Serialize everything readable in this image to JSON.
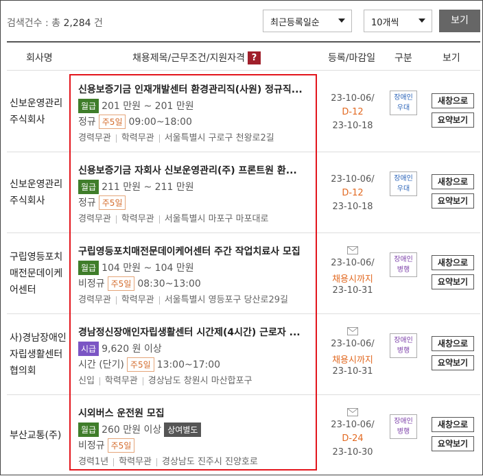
{
  "search": {
    "count_label": "검색건수 : 총",
    "count_value": "2,284",
    "count_unit": "건",
    "sort_selected": "최근등록일순",
    "per_page_selected": "10개씩",
    "view_button": "보기"
  },
  "columns": {
    "company": "회사명",
    "title": "채용제목/근무조건/지원자격",
    "help": "?",
    "dates": "등록/마감일",
    "kind": "구분",
    "view": "보기"
  },
  "buttons": {
    "new_window": "새창으로",
    "summary": "요약보기"
  },
  "jobs": [
    {
      "company": "신보운영관리주식회사",
      "title": "신용보증기금 인재개발센터 환경관리직(사원) 정규직...",
      "pay_type": "월급",
      "pay": "201 만원 ~ 201 만원",
      "employment": "정규",
      "week": "주5일",
      "hours": "09:00~18:00",
      "bonus": "",
      "experience": "경력무관",
      "education": "학력무관",
      "location": "서울특별시 구로구 천왕로2길",
      "registered": "23-10-06/",
      "deadline": "D-12",
      "closing": "23-10-18",
      "kind_line1": "장애인",
      "kind_line2": "우대"
    },
    {
      "company": "신보운영관리주식회사",
      "title": "신용보증기금 자회사 신보운영관리(주) 프론트원 환...",
      "pay_type": "월급",
      "pay": "211 만원 ~ 211 만원",
      "employment": "정규",
      "week": "주5일",
      "hours": "",
      "bonus": "",
      "experience": "경력무관",
      "education": "학력무관",
      "location": "서울특별시 마포구 마포대로",
      "registered": "23-10-06/",
      "deadline": "D-12",
      "closing": "23-10-18",
      "kind_line1": "장애인",
      "kind_line2": "우대"
    },
    {
      "company": "구립영등포치매전문데이케어센터",
      "title": "구립영등포치매전문데이케어센터 주간 작업치료사 모집",
      "pay_type": "월급",
      "pay": "104 만원 ~ 104 만원",
      "employment": "비정규",
      "week": "주5일",
      "hours": "08:30~13:00",
      "bonus": "",
      "experience": "경력무관",
      "education": "학력무관",
      "location": "서울특별시 영등포구 당산로29길",
      "registered": "23-10-06/",
      "deadline": "채용시까지",
      "closing": "23-10-31",
      "kind_line1": "장애인",
      "kind_line2": "병행"
    },
    {
      "company": "사)경남장애인자립생활센터협의회",
      "title": "경남정신장애인자립생활센터 시간제(4시간) 근로자 ...",
      "pay_type": "시급",
      "pay": "9,620 원 이상",
      "employment": "시간 (단기)",
      "week": "주5일",
      "hours": "13:00~17:00",
      "bonus": "",
      "experience": "신입",
      "education": "학력무관",
      "location": "경상남도 창원시 마산합포구",
      "registered": "23-10-06/",
      "deadline": "채용시까지",
      "closing": "23-10-31",
      "kind_line1": "장애인",
      "kind_line2": "병행"
    },
    {
      "company": "부산교통(주)",
      "title": "시외버스 운전원 모집",
      "pay_type": "월급",
      "pay": "260 만원 이상",
      "employment": "비정규",
      "week": "주5일",
      "hours": "",
      "bonus": "상여별도",
      "experience": "경력1년",
      "education": "학력무관",
      "location": "경상남도 진주시 진양호로",
      "registered": "23-10-06/",
      "deadline": "D-24",
      "closing": "23-10-30",
      "kind_line1": "장애인",
      "kind_line2": "병행"
    }
  ]
}
